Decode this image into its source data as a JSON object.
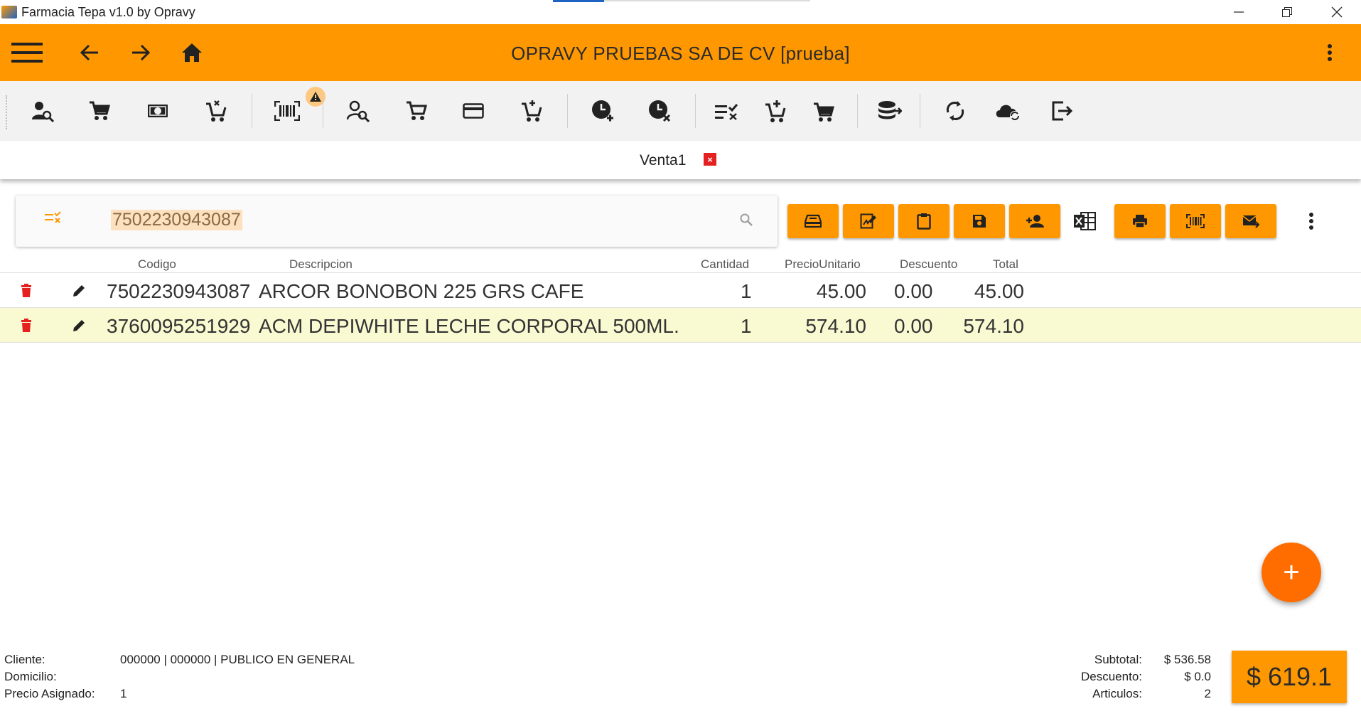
{
  "window": {
    "title": "Farmacia Tepa v1.0 by Opravy"
  },
  "header": {
    "company": "OPRAVY PRUEBAS SA DE CV [prueba]"
  },
  "toolbar": {
    "icons": [
      "user-search-icon",
      "cart-icon",
      "cash-icon",
      "cart-remove-icon",
      "barcode-icon",
      "person-search-icon",
      "cart-outline-icon",
      "credit-card-icon",
      "cart-check-icon",
      "clock-add-icon",
      "clock-remove-icon",
      "list-check-icon",
      "cart-add-icon",
      "cart-arrow-icon",
      "database-export-icon",
      "sync-icon",
      "cloud-sync-icon",
      "logout-icon"
    ]
  },
  "tab": {
    "label": "Venta1",
    "close": "×"
  },
  "search": {
    "value": "7502230943087"
  },
  "table": {
    "headers": {
      "codigo": "Codigo",
      "descripcion": "Descripcion",
      "cantidad": "Cantidad",
      "precio": "PrecioUnitario",
      "descuento": "Descuento",
      "total": "Total"
    },
    "rows": [
      {
        "codigo": "7502230943087",
        "descripcion": "ARCOR BONOBON 225 GRS CAFE",
        "cantidad": "1",
        "precio": "45.00",
        "descuento": "0.00",
        "total": "45.00"
      },
      {
        "codigo": "3760095251929",
        "descripcion": "ACM DEPIWHITE LECHE CORPORAL 500ML.",
        "cantidad": "1",
        "precio": "574.10",
        "descuento": "0.00",
        "total": "574.10"
      }
    ]
  },
  "fab": {
    "label": "+"
  },
  "footer": {
    "cliente_label": "Cliente:",
    "cliente_value": "000000 | 000000 | PUBLICO EN GENERAL",
    "domicilio_label": "Domicilio:",
    "precio_label": "Precio Asignado:",
    "precio_value": "1",
    "subtotal_label": "Subtotal:",
    "subtotal_value": "$ 536.58",
    "descuento_label": "Descuento:",
    "descuento_value": "$ 0.0",
    "articulos_label": "Articulos:",
    "articulos_value": "2",
    "total": "$ 619.1"
  },
  "colors": {
    "accent": "#ff9800",
    "fab": "#ff6d00",
    "delete": "#e52020",
    "selected_row": "#fafad2"
  }
}
